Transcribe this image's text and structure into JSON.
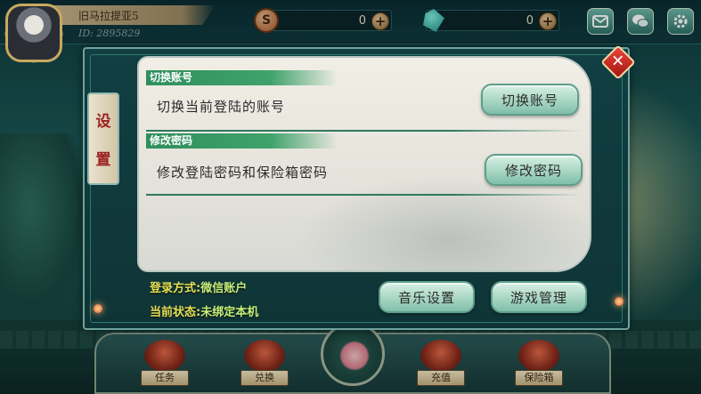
{
  "topbar": {
    "player_name": "旧马拉提亚5",
    "player_id": "ID: 2895829",
    "silver": {
      "value": "0",
      "icon": "S"
    },
    "jade": {
      "value": "0"
    },
    "plus_label": "+"
  },
  "dialog": {
    "tab_chars": [
      "设",
      "置"
    ],
    "close_label": "✕",
    "switch_account": {
      "header": "切换账号",
      "description": "切换当前登陆的账号",
      "button": "切换账号"
    },
    "change_password": {
      "header": "修改密码",
      "description": "修改登陆密码和保险箱密码",
      "button": "修改密码"
    },
    "login_method_label": "登录方式:",
    "login_method_value": "微信账户",
    "device_status_label": "当前状态:",
    "device_status_value": "未绑定本机",
    "music_button": "音乐设置",
    "game_manage_button": "游戏管理"
  },
  "bottom_nav": [
    {
      "label": "任务"
    },
    {
      "label": "兑换"
    },
    {
      "label": "充值"
    },
    {
      "label": "保险箱"
    }
  ],
  "colors": {
    "section_header": "#3fa26b",
    "jade_button": "#a8d6c4",
    "login_label": "#e5e255",
    "close_button": "#e9463b"
  },
  "icons": [
    "mail-icon",
    "wechat-icon",
    "gear-icon",
    "close-icon",
    "silver-coin-icon",
    "jade-gem-icon",
    "lotus-icon"
  ]
}
